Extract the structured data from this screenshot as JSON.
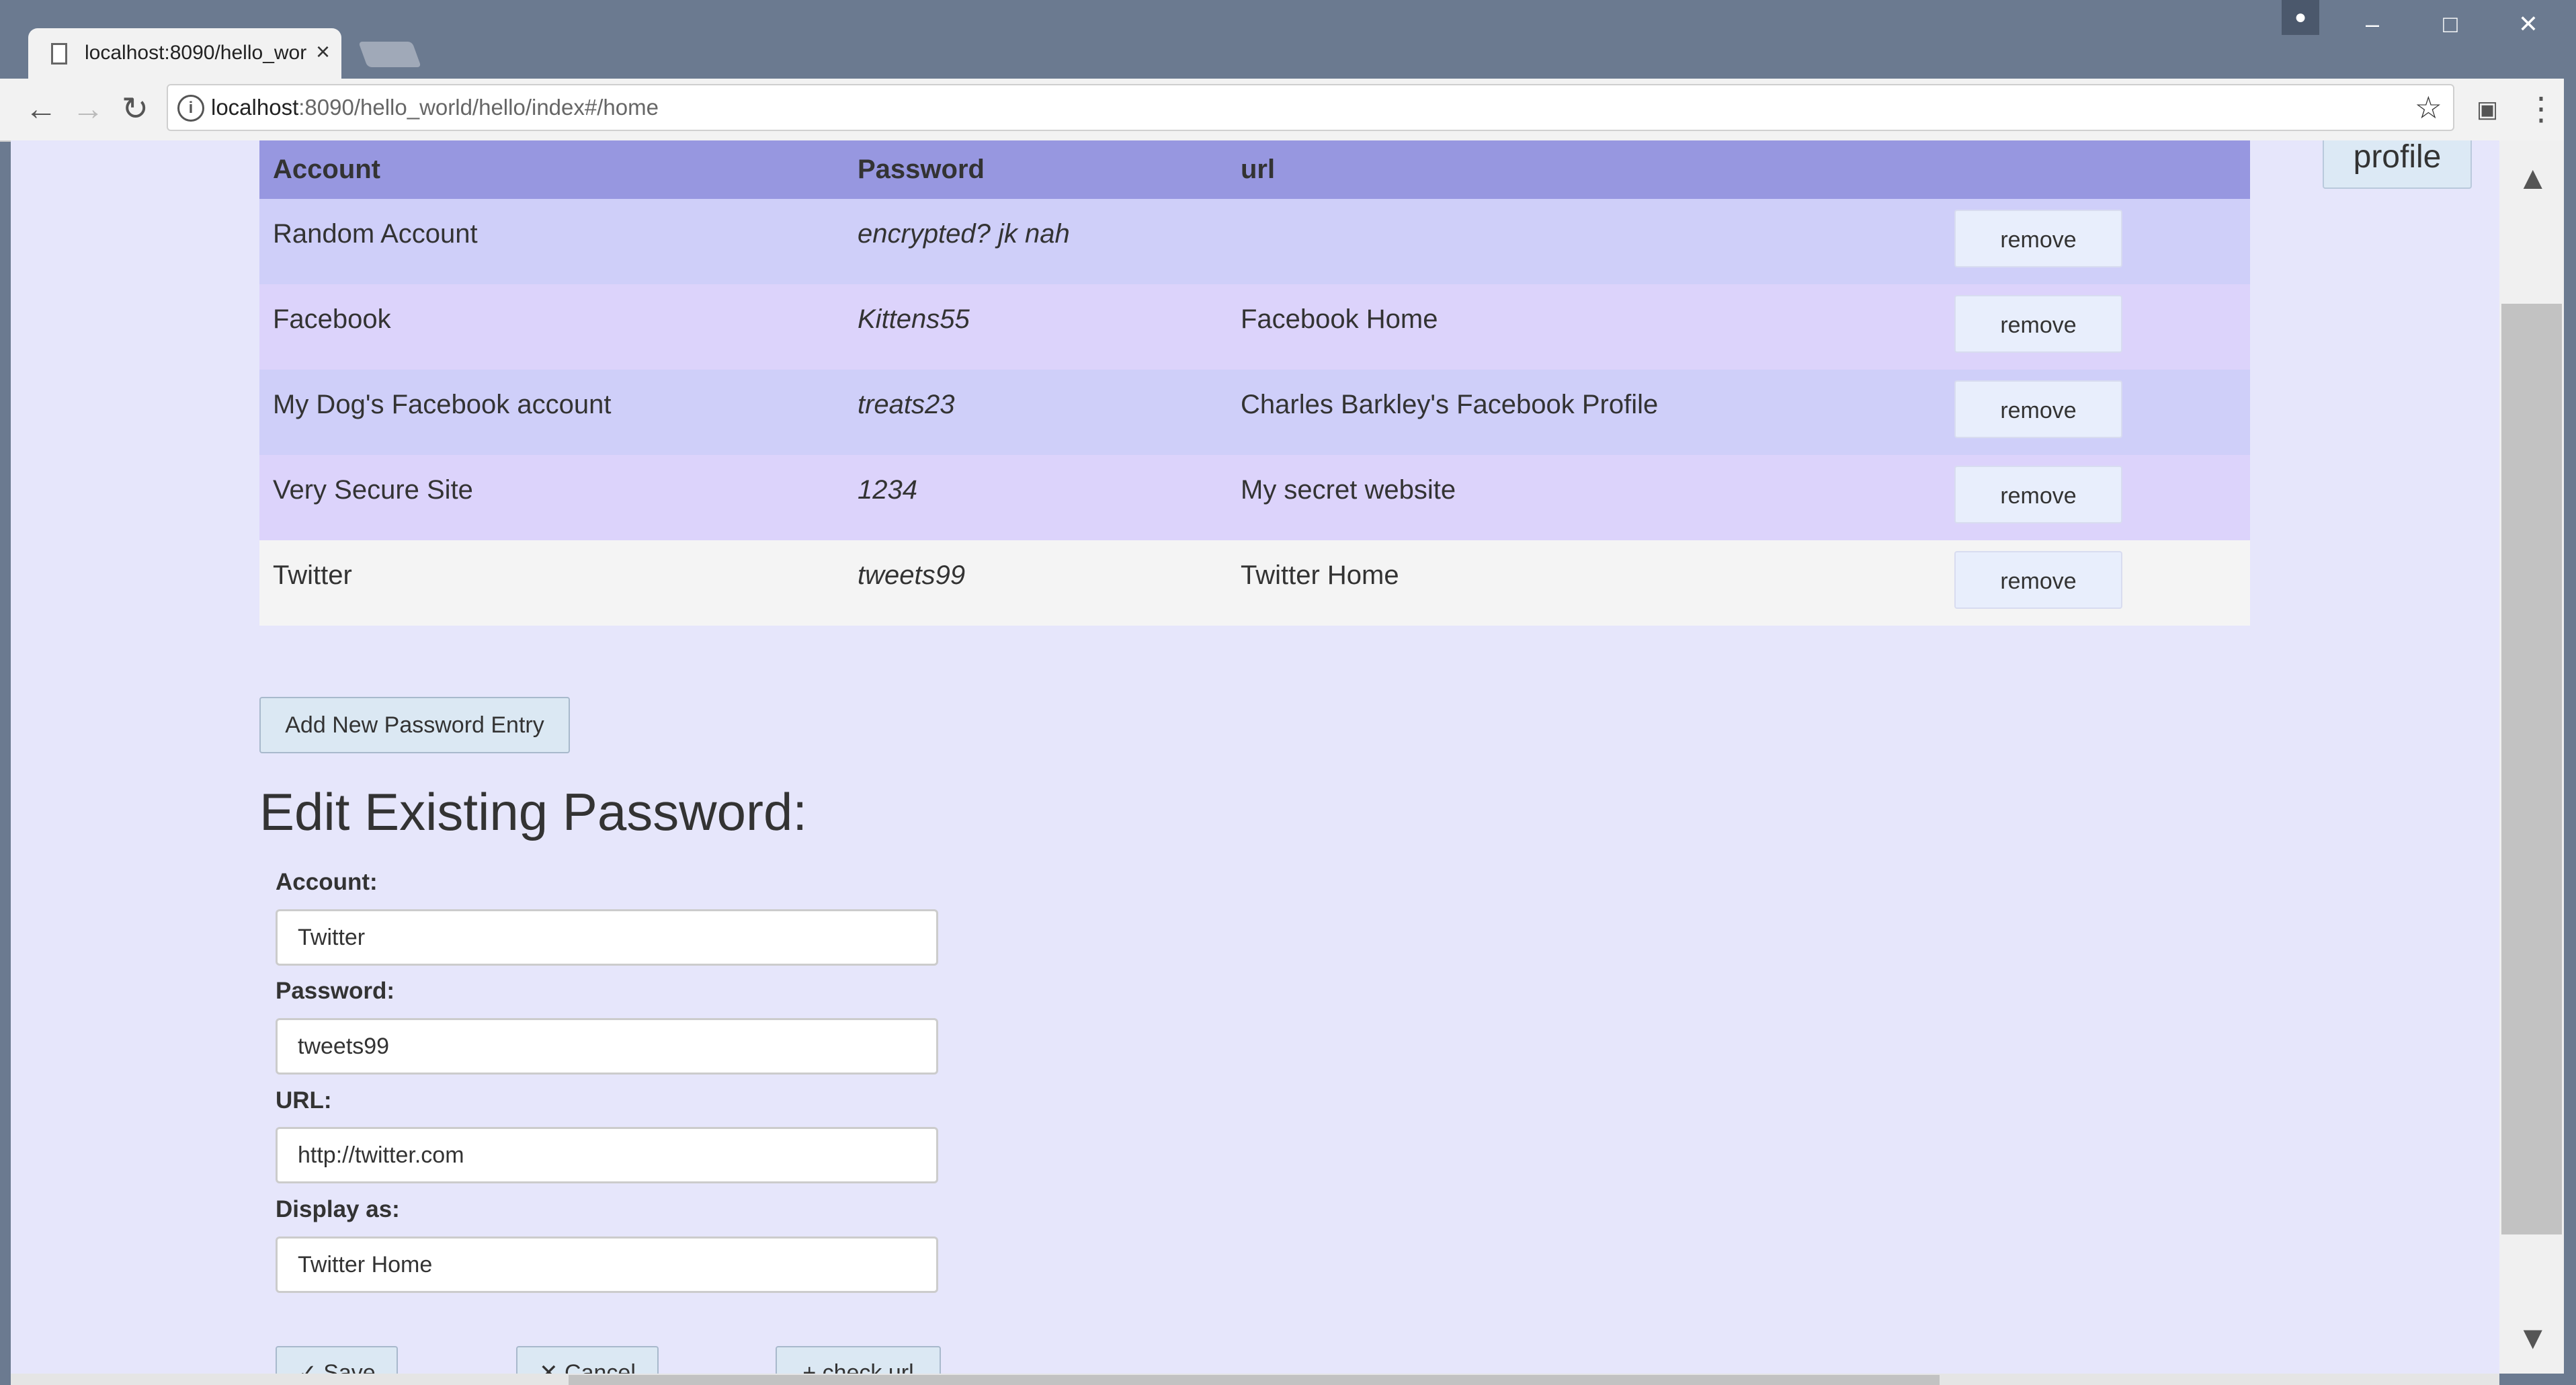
{
  "browser": {
    "tab_title": "localhost:8090/hello_wor",
    "url_host": "localhost",
    "url_rest": ":8090/hello_world/hello/index#/home"
  },
  "header": {
    "profile_label": "profile"
  },
  "table": {
    "columns": [
      "Account",
      "Password",
      "url"
    ],
    "rows": [
      {
        "account": "Random Account",
        "password": "encrypted? jk nah",
        "url": "",
        "action": "remove"
      },
      {
        "account": "Facebook",
        "password": "Kittens55",
        "url": "Facebook Home",
        "action": "remove"
      },
      {
        "account": "My Dog's Facebook account",
        "password": "treats23",
        "url": "Charles Barkley's Facebook Profile",
        "action": "remove"
      },
      {
        "account": "Very Secure Site",
        "password": "1234",
        "url": "My secret website",
        "action": "remove"
      },
      {
        "account": "Twitter",
        "password": "tweets99",
        "url": "Twitter Home",
        "action": "remove"
      }
    ]
  },
  "add_entry_label": "Add New Password Entry",
  "edit_form": {
    "title": "Edit Existing Password:",
    "account_label": "Account:",
    "account_value": "Twitter",
    "password_label": "Password:",
    "password_value": "tweets99",
    "url_label": "URL:",
    "url_value": "http://twitter.com",
    "display_label": "Display as:",
    "display_value": "Twitter Home",
    "save_label": "✓ Save",
    "cancel_label": "✕ Cancel",
    "check_label": "+ check url"
  },
  "colors": {
    "page_bg": "#e6e6fb",
    "header_bg": "#9797e0",
    "row_a": "#cfcff9",
    "row_b": "#dcd3fb"
  }
}
